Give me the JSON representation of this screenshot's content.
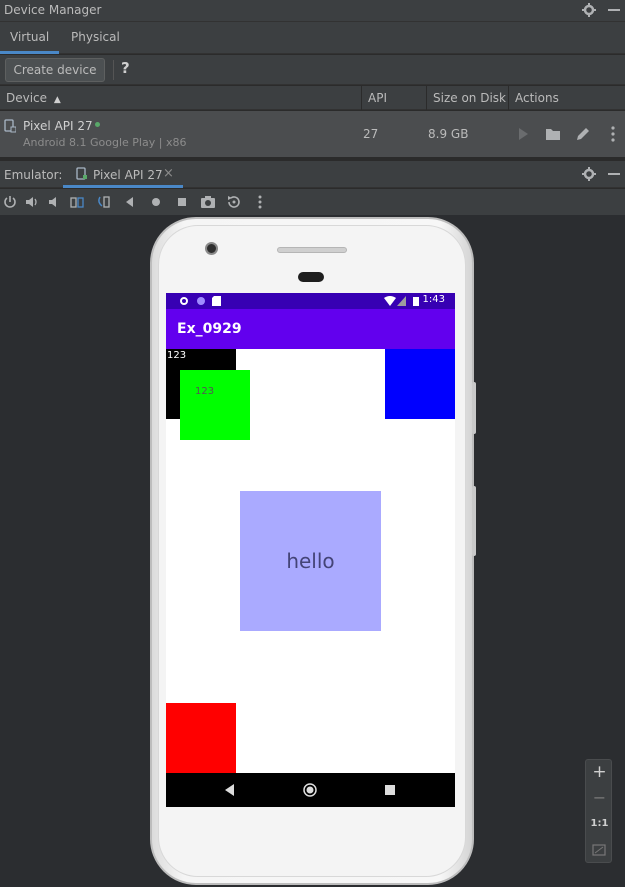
{
  "device_manager": {
    "title": "Device Manager",
    "tabs": [
      {
        "label": "Virtual",
        "active": true
      },
      {
        "label": "Physical",
        "active": false
      }
    ],
    "create_button": "Create device",
    "help": "?",
    "columns": {
      "device": "Device",
      "api": "API",
      "size": "Size on Disk",
      "actions": "Actions"
    },
    "sort_indicator": "▲",
    "rows": [
      {
        "name": "Pixel API 27",
        "subtitle": "Android 8.1 Google Play | x86",
        "api": "27",
        "size": "8.9 GB",
        "online": true
      }
    ]
  },
  "emulator": {
    "label": "Emulator:",
    "tab_label": "Pixel API 27",
    "tab_close": "×",
    "toolbar_icons": [
      "power-icon",
      "volume-up-icon",
      "volume-down-icon",
      "rotate-left-icon",
      "rotate-right-icon",
      "back-icon",
      "home-icon",
      "overview-icon",
      "camera-icon",
      "snapshot-icon",
      "more-icon"
    ]
  },
  "screen": {
    "status_time": "1:43",
    "app_title": "Ex_0929",
    "black_box_text": "123",
    "green_box_text": "123",
    "hello_text": "hello",
    "colors": {
      "black": "#000000",
      "green": "#00ff00",
      "blue": "#0000ff",
      "hello_bg": "#aaaaff",
      "red": "#ff0000",
      "status_bar": "#3700b3",
      "app_bar": "#6200ee"
    }
  },
  "zoom_panel": {
    "zoom_in": "+",
    "zoom_out": "−",
    "actual_size": "1:1"
  },
  "colors": {
    "accent": "#4a88c7",
    "online": "#59a869"
  }
}
